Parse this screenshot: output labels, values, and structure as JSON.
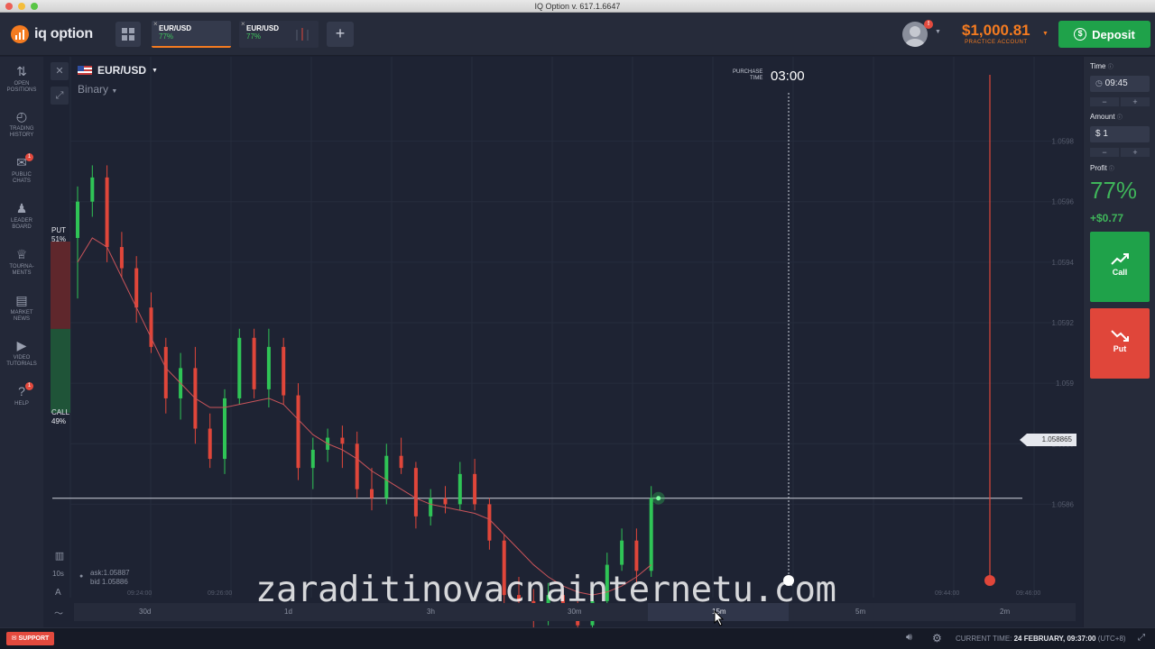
{
  "window": {
    "title": "IQ Option v. 617.1.6647"
  },
  "header": {
    "logo_text": "iq option",
    "tabs": [
      {
        "pair": "EUR/USD",
        "percent": "77%"
      },
      {
        "pair": "EUR/USD",
        "percent": "77%"
      }
    ],
    "balance": "$1,000.81",
    "account_type": "PRACTICE ACCOUNT",
    "deposit_label": "Deposit",
    "notification_count": "!"
  },
  "sidebar": {
    "items": [
      {
        "label1": "OPEN",
        "label2": "POSITIONS",
        "icon": "arrows-updown-icon"
      },
      {
        "label1": "TRADING",
        "label2": "HISTORY",
        "icon": "history-icon"
      },
      {
        "label1": "PUBLIC",
        "label2": "CHATS",
        "icon": "chat-icon",
        "badge": "1"
      },
      {
        "label1": "LEADER",
        "label2": "BOARD",
        "icon": "leaderboard-icon"
      },
      {
        "label1": "TOURNA-",
        "label2": "MENTS",
        "icon": "trophy-icon"
      },
      {
        "label1": "MARKET",
        "label2": "NEWS",
        "icon": "news-icon"
      },
      {
        "label1": "VIDEO",
        "label2": "TUTORIALS",
        "icon": "play-icon"
      },
      {
        "label1": "",
        "label2": "HELP",
        "icon": "help-icon",
        "badge": "1"
      }
    ]
  },
  "chart": {
    "asset": "EUR/USD",
    "option_type": "Binary",
    "purchase_label_1": "PURCHASE",
    "purchase_label_2": "TIME",
    "purchase_time": "03:00",
    "put_label": "PUT",
    "put_percent": "51%",
    "call_label": "CALL",
    "call_percent": "49%",
    "ask": "ask:1.05887",
    "bid": "bid 1.05886",
    "interval": "10s",
    "current_price": "1.058865",
    "time_labels": [
      "09:24:00",
      "09:26:00",
      "09:44:00",
      "09:46:00"
    ],
    "timeframes": [
      "30d",
      "1d",
      "3h",
      "30m",
      "15m",
      "5m",
      "2m"
    ],
    "active_timeframe": "15m"
  },
  "chart_data": {
    "type": "candlestick",
    "y_ticks": [
      "1.0598",
      "1.0596",
      "1.0594",
      "1.0592",
      "1.059",
      "1.0588",
      "1.0586"
    ],
    "ylim": [
      1.0585,
      1.0599
    ],
    "candles": [
      [
        1.05948,
        1.05965,
        1.05928,
        1.0596
      ],
      [
        1.0596,
        1.05972,
        1.05955,
        1.05968
      ],
      [
        1.05968,
        1.05972,
        1.0594,
        1.05945
      ],
      [
        1.05945,
        1.0595,
        1.05935,
        1.05938
      ],
      [
        1.05938,
        1.05942,
        1.0592,
        1.05925
      ],
      [
        1.05925,
        1.0593,
        1.0591,
        1.05912
      ],
      [
        1.05912,
        1.05915,
        1.0589,
        1.05895
      ],
      [
        1.05895,
        1.0591,
        1.05888,
        1.05905
      ],
      [
        1.05905,
        1.05912,
        1.0588,
        1.05885
      ],
      [
        1.05885,
        1.0589,
        1.05872,
        1.05875
      ],
      [
        1.05875,
        1.05898,
        1.0587,
        1.05895
      ],
      [
        1.05895,
        1.05918,
        1.05893,
        1.05915
      ],
      [
        1.05915,
        1.05918,
        1.05895,
        1.05898
      ],
      [
        1.05898,
        1.05918,
        1.05892,
        1.05912
      ],
      [
        1.05912,
        1.05915,
        1.05893,
        1.05896
      ],
      [
        1.05896,
        1.059,
        1.05868,
        1.05872
      ],
      [
        1.05872,
        1.05882,
        1.05865,
        1.05878
      ],
      [
        1.05878,
        1.05885,
        1.05874,
        1.05882
      ],
      [
        1.05882,
        1.05886,
        1.05872,
        1.0588
      ],
      [
        1.0588,
        1.05884,
        1.05862,
        1.05865
      ],
      [
        1.05865,
        1.05872,
        1.05858,
        1.05862
      ],
      [
        1.05862,
        1.0588,
        1.0586,
        1.05876
      ],
      [
        1.05876,
        1.05882,
        1.0587,
        1.05872
      ],
      [
        1.05872,
        1.05874,
        1.05852,
        1.05856
      ],
      [
        1.05856,
        1.05865,
        1.05853,
        1.05862
      ],
      [
        1.05862,
        1.05866,
        1.05857,
        1.0586
      ],
      [
        1.0586,
        1.05874,
        1.05858,
        1.0587
      ],
      [
        1.0587,
        1.05875,
        1.05858,
        1.0586
      ],
      [
        1.0586,
        1.05862,
        1.05845,
        1.05848
      ],
      [
        1.05848,
        1.0585,
        1.05826,
        1.0583
      ],
      [
        1.0583,
        1.05836,
        1.05824,
        1.05828
      ],
      [
        1.05828,
        1.05832,
        1.05816,
        1.05822
      ],
      [
        1.05822,
        1.05834,
        1.0582,
        1.0583
      ],
      [
        1.0583,
        1.05832,
        1.05822,
        1.05826
      ],
      [
        1.05826,
        1.05828,
        1.05816,
        1.0582
      ],
      [
        1.0582,
        1.05832,
        1.05818,
        1.05828
      ],
      [
        1.05828,
        1.05844,
        1.05826,
        1.0584
      ],
      [
        1.0584,
        1.05852,
        1.05838,
        1.05848
      ],
      [
        1.05848,
        1.05852,
        1.05834,
        1.05838
      ],
      [
        1.05838,
        1.05866,
        1.05836,
        1.05862
      ]
    ],
    "ma_values": [
      1.0594,
      1.05948,
      1.05945,
      1.05935,
      1.05925,
      1.05915,
      1.05905,
      1.059,
      1.05895,
      1.05892,
      1.05892,
      1.05893,
      1.05894,
      1.05895,
      1.05893,
      1.05888,
      1.05883,
      1.0588,
      1.05878,
      1.05875,
      1.05871,
      1.05868,
      1.05865,
      1.05862,
      1.0586,
      1.05859,
      1.05858,
      1.05857,
      1.05855,
      1.0585,
      1.05845,
      1.0584,
      1.05836,
      1.05833,
      1.05831,
      1.0583,
      1.05831,
      1.05833,
      1.05836,
      1.0584
    ]
  },
  "trade_panel": {
    "time_label": "Time",
    "time_value": "09:45",
    "amount_label": "Amount",
    "amount_currency": "$",
    "amount_value": "1",
    "profit_label": "Profit",
    "profit_percent": "77%",
    "profit_amount": "+$0.77",
    "call_label": "Call",
    "put_label": "Put",
    "minus": "−",
    "plus": "+"
  },
  "watermark": "zaraditinovacnainternetu.com",
  "footer": {
    "support_label": "SUPPORT",
    "current_time_label": "CURRENT TIME:",
    "current_time_value": "24 FEBRUARY, 09:37:00",
    "timezone": "(UTC+8)"
  },
  "colors": {
    "up": "#2fc456",
    "down": "#e0463a",
    "accent": "#f47b20",
    "deposit": "#1fa24a",
    "call": "#1fa24a",
    "put": "#e0463a"
  }
}
